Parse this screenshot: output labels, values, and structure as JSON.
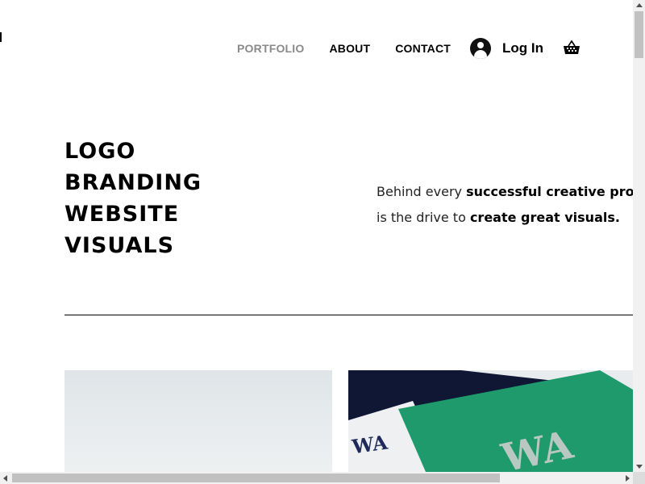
{
  "nav": {
    "items": [
      {
        "label": "PORTFOLIO",
        "active": true
      },
      {
        "label": "ABOUT",
        "active": false
      },
      {
        "label": "CONTACT",
        "active": false
      }
    ],
    "login_label": "Log In",
    "icons": {
      "avatar": "user-avatar-icon",
      "cart": "shopping-basket-icon"
    }
  },
  "hero": {
    "title_lines": [
      "LOGO",
      "BRANDING",
      "WEBSITE",
      "VISUALS"
    ],
    "text": {
      "line1_plain": "Behind every ",
      "line1_bold": "successful creative pro",
      "line2_plain": "is the drive to ",
      "line2_bold": "create great visuals."
    }
  },
  "colors": {
    "accent_green": "#1e9a6c",
    "navy": "#0f1734",
    "active_nav": "#8a8a8a"
  }
}
